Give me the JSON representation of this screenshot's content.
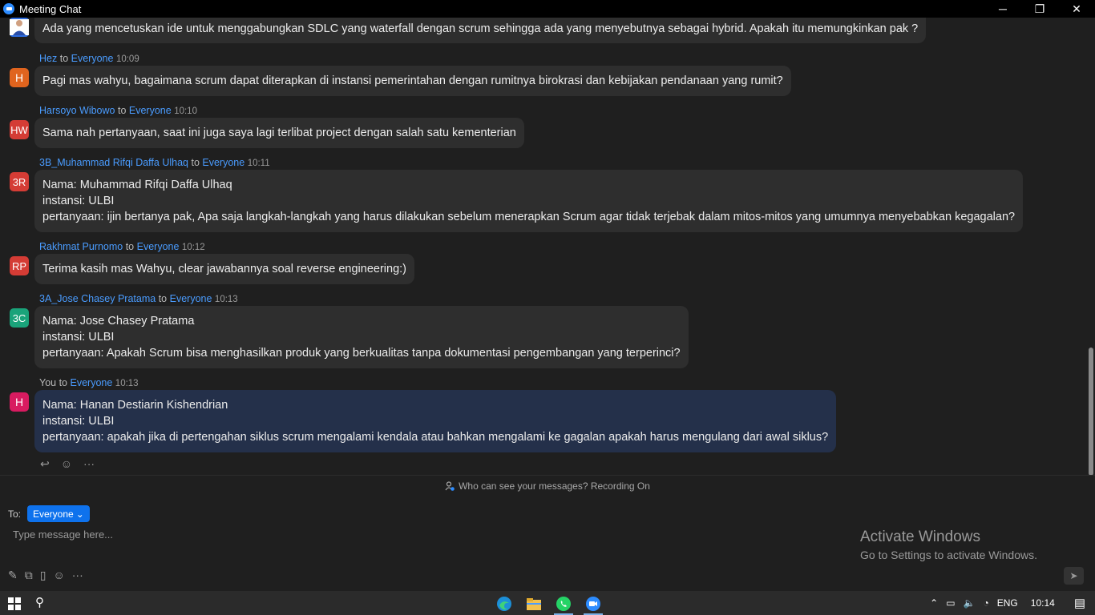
{
  "window": {
    "title": "Meeting Chat",
    "minimize": "─",
    "restore": "❐",
    "close": "✕"
  },
  "messages": [
    {
      "sender": "",
      "to": "",
      "recipient": "",
      "time": "",
      "initials": "",
      "avatar_color": "#2d6cdf",
      "lines": [
        "Ada yang mencetuskan ide untuk menggabungkan SDLC yang waterfall dengan scrum sehingga ada yang menyebutnya sebagai hybrid. Apakah itu memungkinkan pak ?"
      ]
    },
    {
      "sender": "Hez",
      "to": "to",
      "recipient": "Everyone",
      "time": "10:09",
      "initials": "H",
      "avatar_color": "#e0641e",
      "lines": [
        "Pagi mas wahyu, bagaimana scrum dapat diterapkan di instansi pemerintahan dengan rumitnya birokrasi dan kebijakan pendanaan yang rumit?"
      ]
    },
    {
      "sender": "Harsoyo Wibowo",
      "to": "to",
      "recipient": "Everyone",
      "time": "10:10",
      "initials": "HW",
      "avatar_color": "#d43c35",
      "lines": [
        "Sama nah pertanyaan, saat ini juga saya lagi terlibat project dengan salah satu kementerian"
      ]
    },
    {
      "sender": "3B_Muhammad Rifqi Daffa Ulhaq",
      "to": "to",
      "recipient": "Everyone",
      "time": "10:11",
      "initials": "3R",
      "avatar_color": "#d43c35",
      "lines": [
        "Nama: Muhammad Rifqi Daffa Ulhaq",
        "instansi: ULBI",
        "pertanyaan: ijin bertanya pak, Apa saja langkah-langkah yang harus dilakukan sebelum menerapkan Scrum agar tidak terjebak dalam mitos-mitos yang umumnya menyebabkan kegagalan?"
      ]
    },
    {
      "sender": "Rakhmat Purnomo",
      "to": "to",
      "recipient": "Everyone",
      "time": "10:12",
      "initials": "RP",
      "avatar_color": "#d43c35",
      "lines": [
        "Terima kasih mas Wahyu, clear jawabannya soal reverse engineering:)"
      ]
    },
    {
      "sender": "3A_Jose Chasey Pratama",
      "to": "to",
      "recipient": "Everyone",
      "time": "10:13",
      "initials": "3C",
      "avatar_color": "#1aa37a",
      "lines": [
        "Nama: Jose Chasey Pratama",
        "instansi: ULBI",
        "pertanyaan: Apakah Scrum bisa menghasilkan produk yang berkualitas tanpa dokumentasi pengembangan yang terperinci?"
      ]
    },
    {
      "sender": "You",
      "to": "to",
      "recipient": "Everyone",
      "time": "10:13",
      "initials": "H",
      "avatar_color": "#d81b60",
      "lines": [
        "Nama: Hanan Destiarin Kishendrian",
        "instansi: ULBI",
        "pertanyaan: apakah jika di pertengahan siklus scrum mengalami kendala atau bahkan mengalami ke gagalan apakah harus mengulang dari awal siklus?"
      ]
    }
  ],
  "message_actions": {
    "reply_icon": "↩",
    "emoji_icon": "☺",
    "more_icon": "···"
  },
  "info_bar": {
    "text": "Who can see your messages? Recording On"
  },
  "compose": {
    "to_label": "To:",
    "recipient": "Everyone",
    "placeholder": "Type message here...",
    "tools": [
      "✎",
      "⧉",
      "▯",
      "☺",
      "···"
    ],
    "send_icon": "➤"
  },
  "watermark": {
    "line1": "Activate Windows",
    "line2": "Go to Settings to activate Windows."
  },
  "taskbar": {
    "search_icon": "⚲",
    "lang": "ENG",
    "clock": "10:14",
    "chevron": "⌃",
    "battery_icon": "▭",
    "volume_icon": "🔈",
    "wifi_icon": "◔",
    "notification_icon": "▤"
  }
}
